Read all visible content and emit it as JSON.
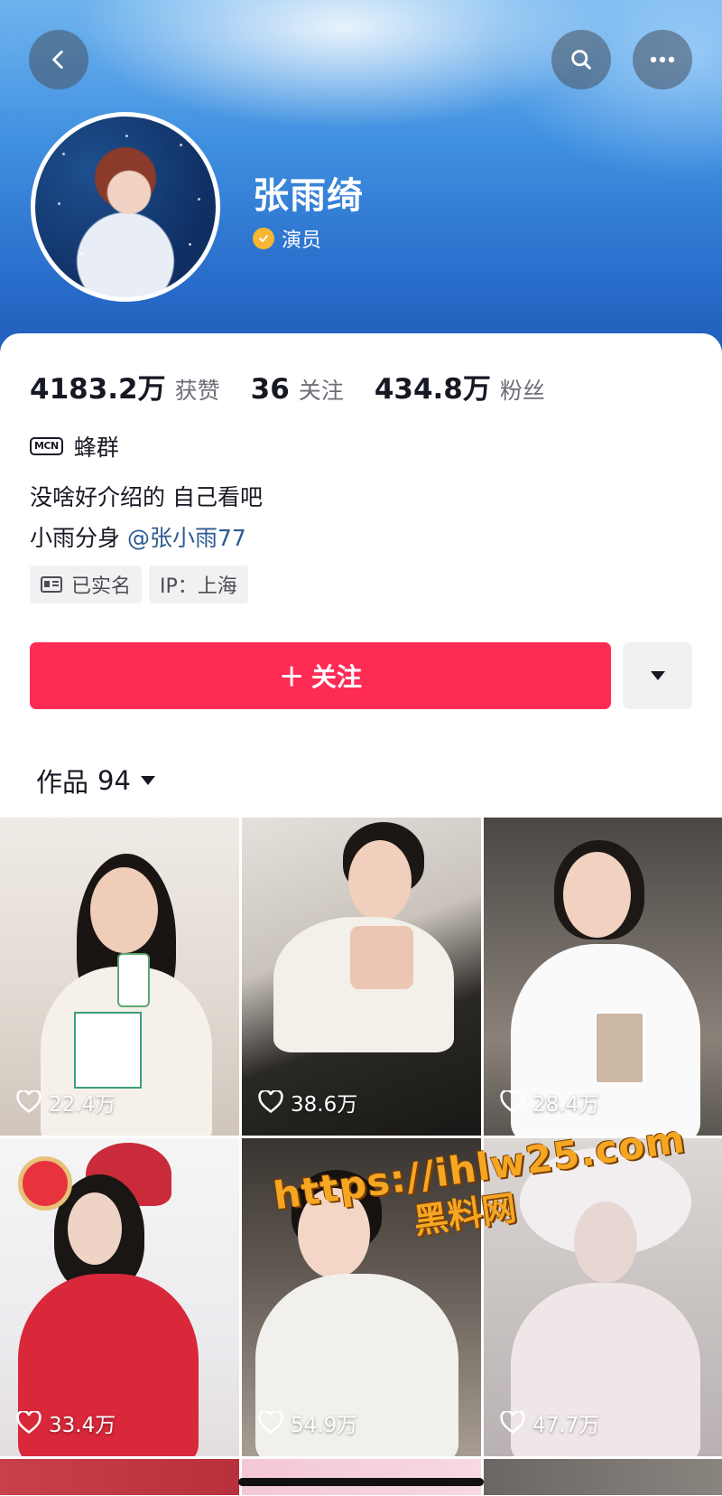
{
  "header": {
    "username": "张雨绮",
    "verification": "演员"
  },
  "stats": [
    {
      "value": "4183.2万",
      "label": "获赞"
    },
    {
      "value": "36",
      "label": "关注"
    },
    {
      "value": "434.8万",
      "label": "粉丝"
    }
  ],
  "profile": {
    "mcn_badge": "MCN",
    "mcn_name": "蜂群",
    "bio_line1": "没啥好介绍的 自己看吧",
    "bio_line2_prefix": "小雨分身",
    "bio_mention": "@张小雨77",
    "tags": [
      {
        "icon": "id-card-icon",
        "text": "已实名"
      },
      {
        "icon": "",
        "text": "IP：上海"
      }
    ]
  },
  "actions": {
    "follow_label": "＋ 关注"
  },
  "works": {
    "label": "作品",
    "count": "94"
  },
  "videos": [
    {
      "likes": "22.4万"
    },
    {
      "likes": "38.6万"
    },
    {
      "likes": "28.4万"
    },
    {
      "likes": "33.4万"
    },
    {
      "likes": "54.9万"
    },
    {
      "likes": "47.7万"
    }
  ],
  "watermark": {
    "url": "https://ihlw25.com",
    "sub": "黑料网"
  },
  "colors": {
    "accent": "#fe2c55",
    "mention": "#2d5b91",
    "verify": "#f7b731"
  }
}
